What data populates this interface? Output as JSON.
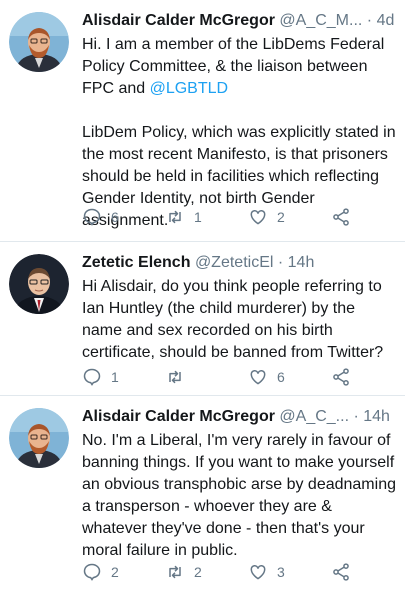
{
  "colors": {
    "link": "#1da1f2",
    "muted": "#657786",
    "text": "#14171a",
    "divider": "#e1e8ed"
  },
  "tweets": [
    {
      "name": "Alisdair Calder McGregor",
      "handle": "@A_C_M...",
      "dot": "·",
      "time": "4d",
      "text_part1": "Hi. I am a member of the LibDems Federal Policy Committee, & the liaison between FPC and ",
      "mention": "@LGBTLD",
      "text_part2": "\n\nLibDem Policy, which was explicitly stated in the most recent Manifesto, is that prisoners should be held in facilities which reflecting Gender Identity, not birth Gender assignment.",
      "replies": "6",
      "retweets": "1",
      "likes": "2"
    },
    {
      "name": "Zetetic Elench",
      "handle": "@ZeteticEl",
      "dot": "·",
      "time": "14h",
      "text": "Hi Alisdair, do you think people referring to Ian Huntley (the child murderer) by the name and sex recorded on his birth certificate, should be banned from Twitter?",
      "replies": "1",
      "retweets": "",
      "likes": "6"
    },
    {
      "name": "Alisdair Calder McGregor",
      "handle": "@A_C_...",
      "dot": "·",
      "time": "14h",
      "text": "No. I'm a Liberal, I'm very rarely in favour of banning things. If you want to make yourself an obvious transphobic arse by deadnaming a transperson - whoever they are & whatever they've done - then that's your moral failure in public.",
      "replies": "2",
      "retweets": "2",
      "likes": "3"
    }
  ]
}
